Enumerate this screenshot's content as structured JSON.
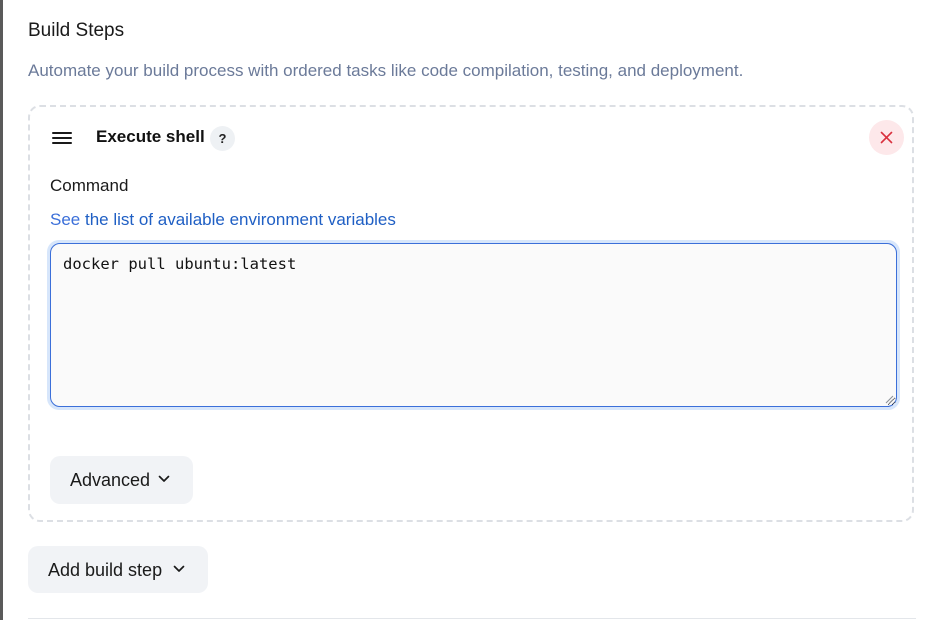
{
  "section": {
    "title": "Build Steps",
    "description": "Automate your build process with ordered tasks like code compilation, testing, and deployment."
  },
  "step": {
    "title": "Execute shell",
    "help_label": "?",
    "field_label": "Command",
    "hint_prefix": "See ",
    "hint_link": "the list of available environment variables",
    "command_value": "docker pull ubuntu:latest",
    "advanced_label": "Advanced"
  },
  "actions": {
    "add_step_label": "Add build step"
  },
  "icons": {
    "drag": "drag-handle-icon",
    "delete": "close-icon",
    "chevron": "chevron-down-icon"
  },
  "colors": {
    "accent": "#3b6fd9",
    "delete_bg": "#fde8ea",
    "delete_fg": "#d9303e",
    "muted_text": "#6b7a99"
  }
}
